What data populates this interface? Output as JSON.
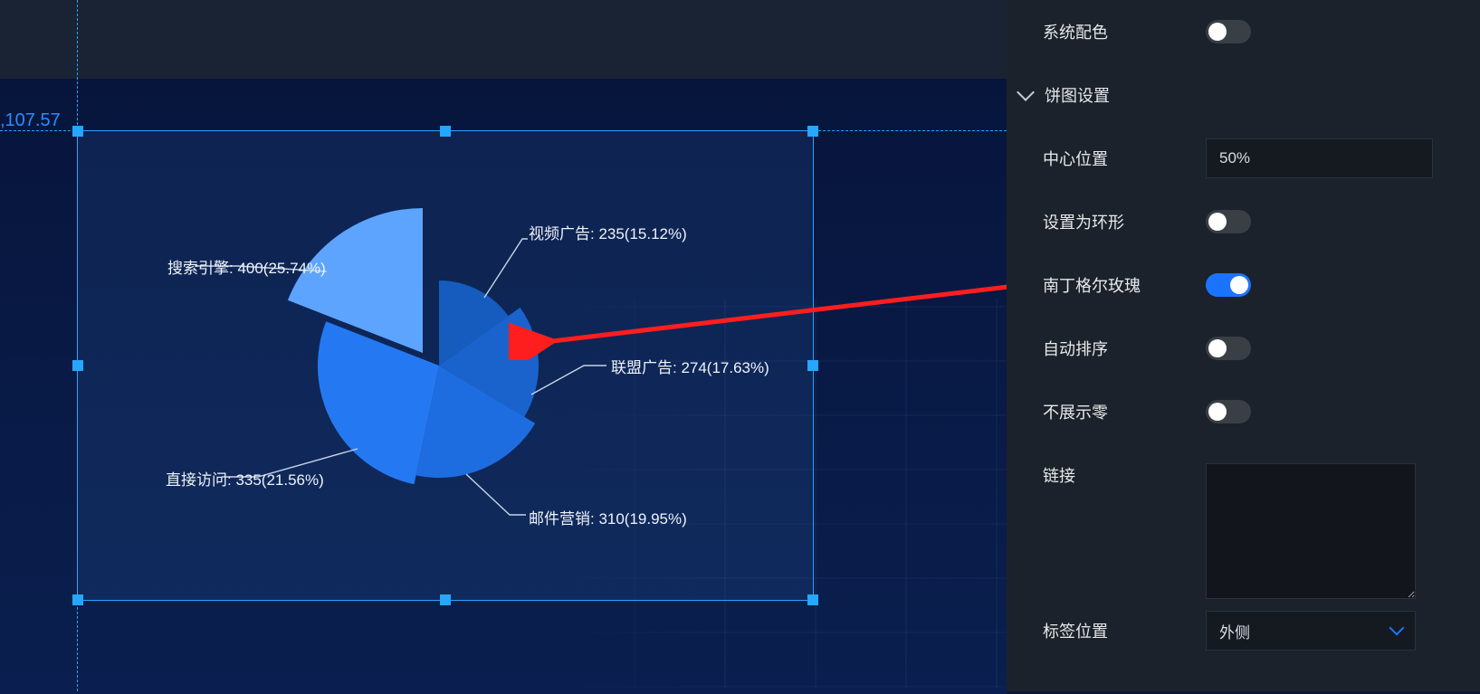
{
  "canvas": {
    "coord_label": ",107.57"
  },
  "chart_data": {
    "type": "pie",
    "rose": true,
    "title": "",
    "series": [
      {
        "name": "视频广告",
        "value": 235,
        "percent": 15.12,
        "color": "#165cbf"
      },
      {
        "name": "联盟广告",
        "value": 274,
        "percent": 17.63,
        "color": "#1a63cd"
      },
      {
        "name": "邮件营销",
        "value": 310,
        "percent": 19.95,
        "color": "#1e6de0"
      },
      {
        "name": "直接访问",
        "value": 335,
        "percent": 21.56,
        "color": "#2479f2"
      },
      {
        "name": "搜索引擎",
        "value": 400,
        "percent": 25.74,
        "color": "#5da4ff"
      }
    ],
    "labels": {
      "video": "视频广告: 235(15.12%)",
      "union": "联盟广告: 274(17.63%)",
      "mail": "邮件营销: 310(19.95%)",
      "direct": "直接访问: 335(21.56%)",
      "search": "搜索引擎: 400(25.74%)"
    }
  },
  "panel": {
    "system_color_label": "系统配色",
    "section_label": "饼图设置",
    "center_label": "中心位置",
    "center_value": "50%",
    "ring_label": "设置为环形",
    "rose_label": "南丁格尔玫瑰",
    "autosort_label": "自动排序",
    "hidezero_label": "不展示零",
    "link_label": "链接",
    "link_value": "",
    "label_pos_label": "标签位置",
    "label_pos_value": "外侧",
    "toggles": {
      "system_color": false,
      "ring": false,
      "rose": true,
      "autosort": false,
      "hidezero": false
    }
  }
}
